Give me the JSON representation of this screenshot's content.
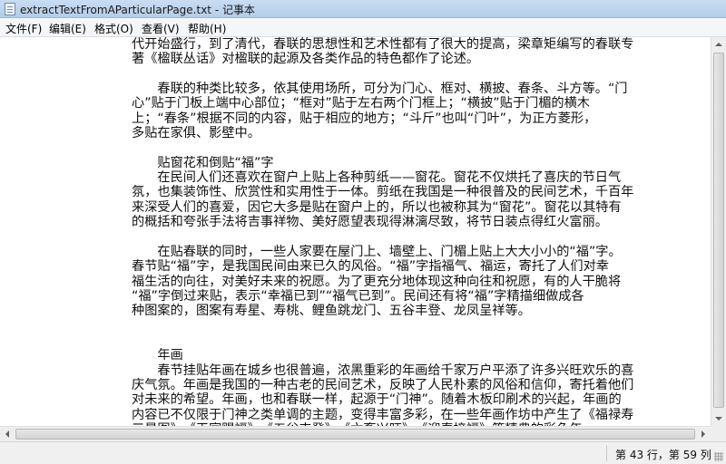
{
  "window": {
    "title": "extractTextFromAParticularPage.txt - 记事本",
    "icon": "notepad-icon"
  },
  "menu": {
    "file": "文件(F)",
    "edit": "编辑(E)",
    "format": "格式(O)",
    "view": "查看(V)",
    "help": "帮助(H)"
  },
  "editor": {
    "lines": [
      "代开始盛行，到了清代，春联的思想性和艺术性都有了很大的提高，梁章矩编写的春联专",
      "著《楹联丛话》对楹联的起源及各类作品的特色都作了论述。",
      "",
      "　　春联的种类比较多，依其使用场所，可分为门心、框对、横披、春条、斗方等。“门",
      "心”贴于门板上端中心部位；“框对”贴于左右两个门框上；“横披”贴于门楣的横木",
      "上；“春条”根据不同的内容，贴于相应的地方；“斗斤”也叫“门叶”，为正方菱形，",
      "多贴在家俱、影壁中。",
      "",
      "　　贴窗花和倒贴“福”字",
      "　　在民间人们还喜欢在窗户上贴上各种剪纸——窗花。窗花不仅烘托了喜庆的节日气",
      "氛，也集装饰性、欣赏性和实用性于一体。剪纸在我国是一种很普及的民间艺术，千百年",
      "来深受人们的喜爱，因它大多是贴在窗户上的，所以也被称其为“窗花”。窗花以其特有",
      "的概括和夸张手法将吉事祥物、美好愿望表现得淋漓尽致，将节日装点得红火富丽。",
      "",
      "　　在贴春联的同时，一些人家要在屋门上、墙壁上、门楣上贴上大大小小的“福”字。",
      "春节贴“福”字，是我国民间由来已久的风俗。“福”字指福气、福运，寄托了人们对幸",
      "福生活的向往，对美好未来的祝愿。为了更充分地体现这种向往和祝愿，有的人干脆将",
      "“福”字倒过来贴，表示“幸福已到”“福气已到”。民间还有将“福”字精描细做成各",
      "种图案的，图案有寿星、寿桃、鲤鱼跳龙门、五谷丰登、龙凤呈祥等。",
      "",
      "",
      "　　年画",
      "　　春节挂贴年画在城乡也很普遍，浓黑重彩的年画给千家万户平添了许多兴旺欢乐的喜",
      "庆气氛。年画是我国的一种古老的民间艺术，反映了人民朴素的风俗和信仰，寄托着他们",
      "对未来的希望。年画，也和春联一样，起源于“门神”。随着木板印刷术的兴起，年画的",
      "内容已不仅限于门神之类单调的主题，变得丰富多彩，在一些年画作坊中产生了《福禄寿",
      "三星图》、《天官赐福》、《五谷丰登》、《六畜兴旺》、《迎春接福》等精典的彩色年"
    ]
  },
  "status": {
    "position": "第 43 行，第 59 列"
  }
}
